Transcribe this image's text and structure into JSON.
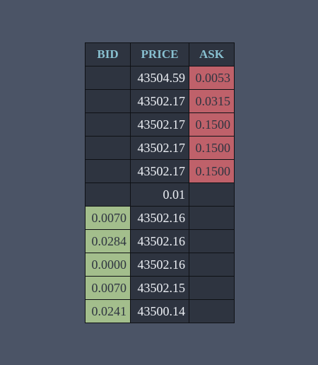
{
  "headers": {
    "bid": "BID",
    "price": "PRICE",
    "ask": "ASK"
  },
  "asks": [
    {
      "bid": "",
      "price": "43504.59",
      "ask": "0.0053"
    },
    {
      "bid": "",
      "price": "43502.17",
      "ask": "0.0315"
    },
    {
      "bid": "",
      "price": "43502.17",
      "ask": "0.1500"
    },
    {
      "bid": "",
      "price": "43502.17",
      "ask": "0.1500"
    },
    {
      "bid": "",
      "price": "43502.17",
      "ask": "0.1500"
    }
  ],
  "spread": {
    "value": "0.01"
  },
  "bids": [
    {
      "bid": "0.0070",
      "price": "43502.16",
      "ask": ""
    },
    {
      "bid": "0.0284",
      "price": "43502.16",
      "ask": ""
    },
    {
      "bid": "0.0000",
      "price": "43502.16",
      "ask": ""
    },
    {
      "bid": "0.0070",
      "price": "43502.15",
      "ask": ""
    },
    {
      "bid": "0.0241",
      "price": "43500.14",
      "ask": ""
    }
  ],
  "colors": {
    "background": "#4b5466",
    "table_bg": "#2e3440",
    "header_text": "#88c0d0",
    "bid": "#a3be8c",
    "ask": "#bf616a",
    "price_text": "#eceff4"
  }
}
